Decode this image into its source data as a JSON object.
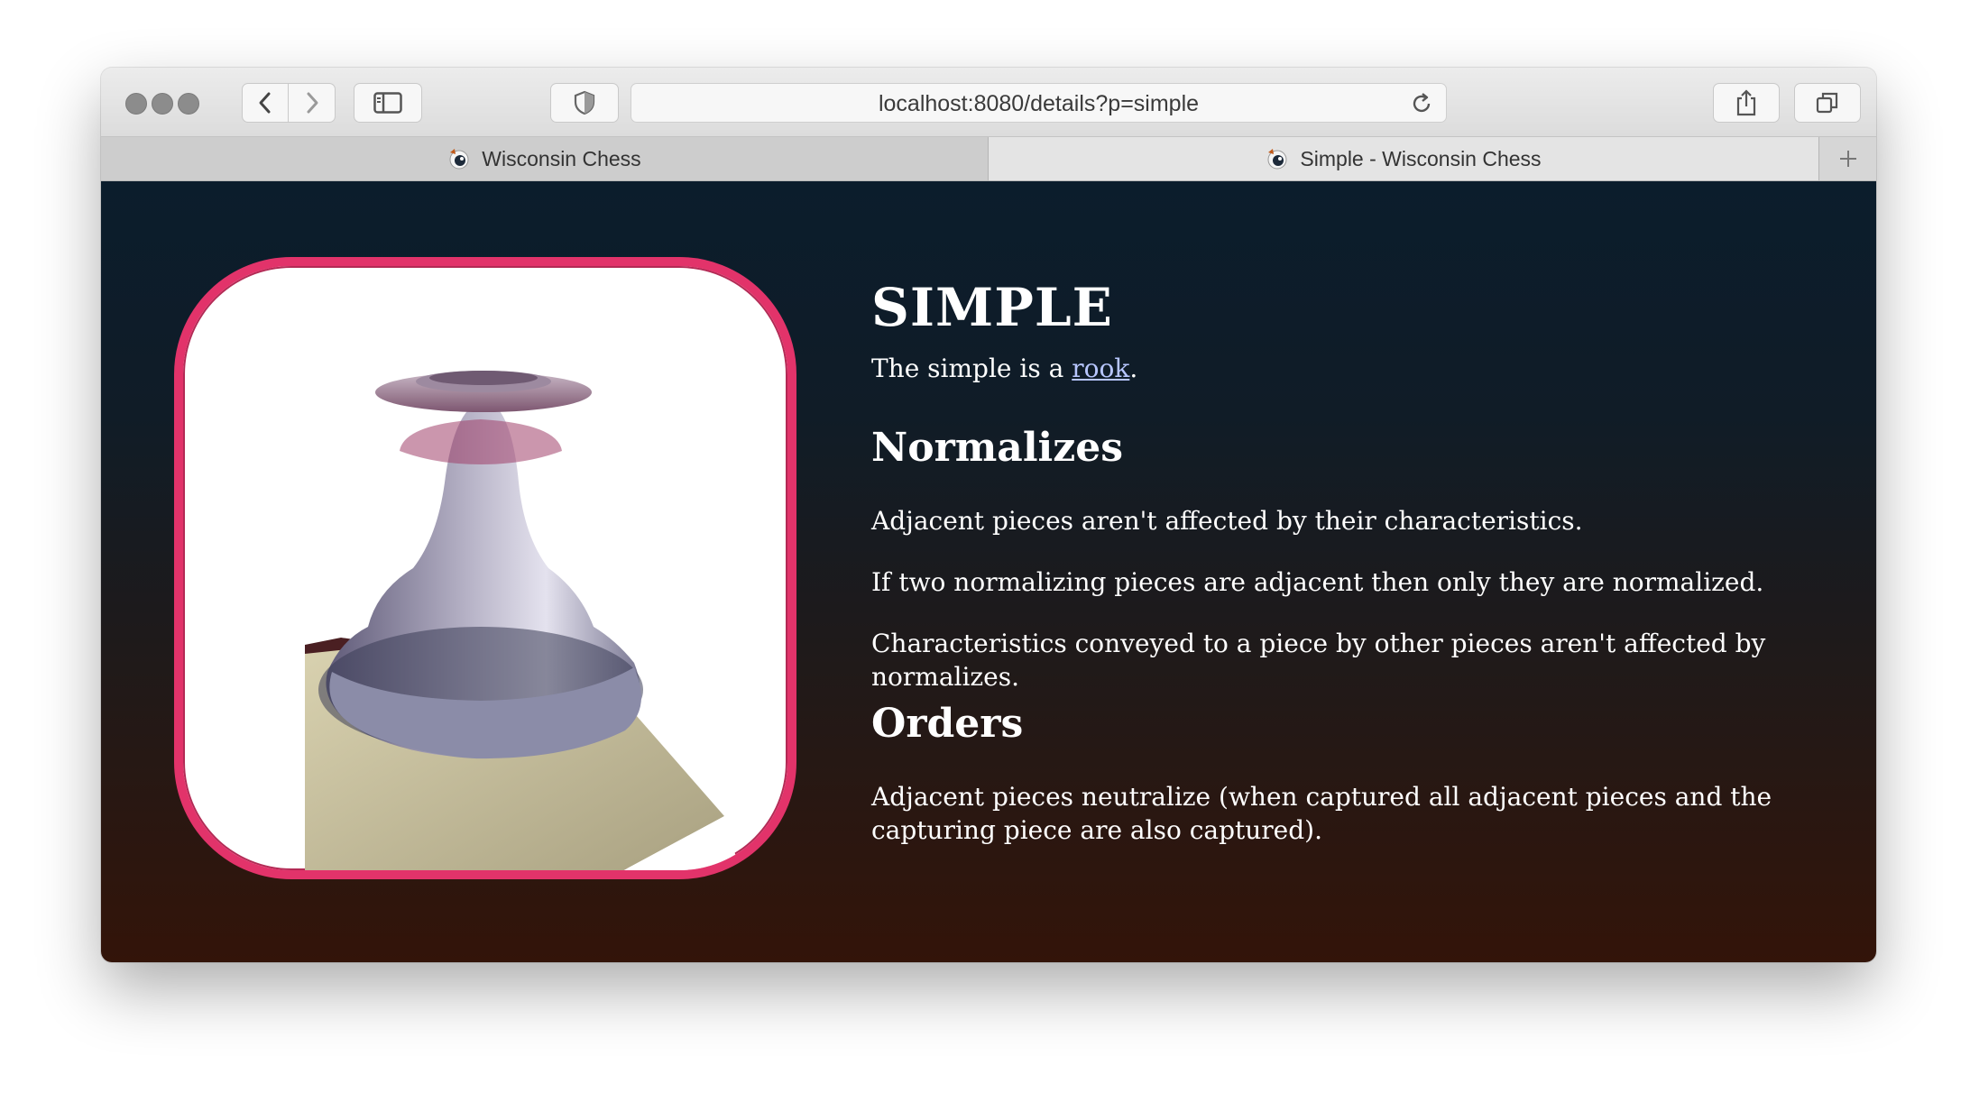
{
  "browser": {
    "url": "localhost:8080/details?p=simple",
    "tabs": [
      {
        "label": "Wisconsin Chess",
        "active": false
      },
      {
        "label": "Simple - Wisconsin Chess",
        "active": true
      }
    ],
    "icons": [
      "close-light",
      "minimize-light",
      "zoom-light",
      "back-chevron-icon",
      "forward-chevron-icon",
      "sidebar-icon",
      "shield-icon",
      "reload-icon",
      "share-icon",
      "tabs-overview-icon",
      "plus-icon"
    ]
  },
  "page": {
    "title": "SIMPLE",
    "intro_prefix": "The simple is a ",
    "intro_link": "rook",
    "intro_suffix": ".",
    "sections": [
      {
        "heading": "Normalizes",
        "paragraphs": [
          "Adjacent pieces aren't affected by their characteristics.",
          "If two normalizing pieces are adjacent then only they are normalized.",
          "Characteristics conveyed to a piece by other pieces aren't affected by normalizes."
        ]
      },
      {
        "heading": "Orders",
        "paragraphs": [
          "Adjacent pieces neutralize (when captured all adjacent pieces and the capturing piece are also captured)."
        ]
      }
    ],
    "colors": {
      "frame_border": "#e2336a",
      "link": "#b7c6ff",
      "bg_top": "#0b1d2c",
      "bg_bottom": "#331409"
    }
  }
}
